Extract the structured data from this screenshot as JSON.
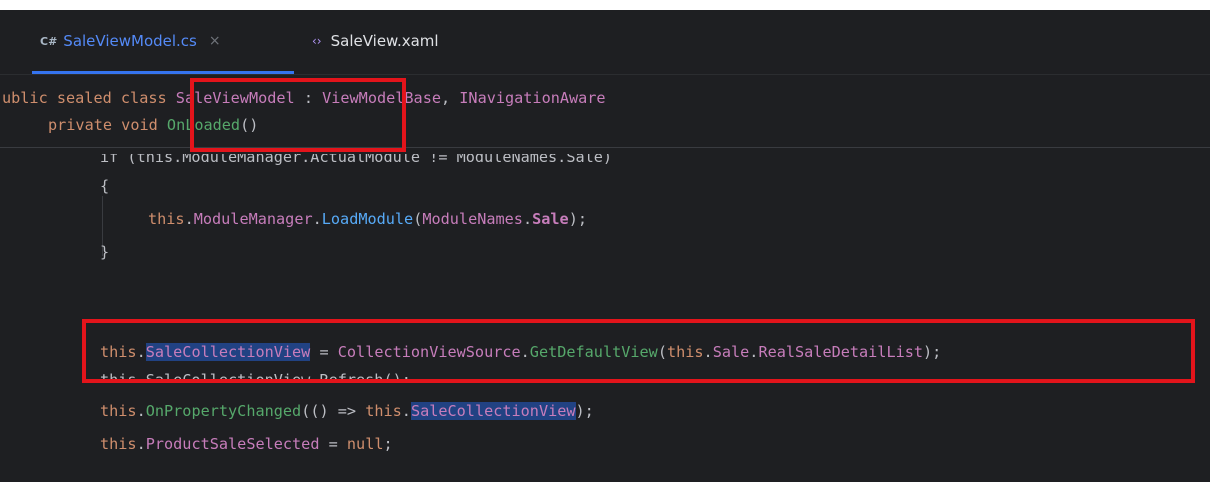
{
  "tabs": [
    {
      "icon": "C#",
      "label": "SaleViewModel.cs",
      "close": "×",
      "active": true
    },
    {
      "icon": "‹›",
      "label": "SaleView.xaml",
      "active": false
    }
  ],
  "sticky": {
    "line1": {
      "kw1": "ublic",
      "kw2": "sealed",
      "kw3": "cl",
      "kw3b": "ass",
      "class_name": "SaleViewModel",
      "sep": " : ",
      "base": "ViewModelBase",
      "comma": ", ",
      "iface": "INavigationAware"
    },
    "line2": {
      "kw1": "private",
      "kw2": "voi",
      "kw2b": "d",
      "method": "OnLoaded",
      "parens": "()"
    }
  },
  "code": {
    "cut_line": "if (this.ModuleManager.ActualModule != ModuleNames.Sale)",
    "open_brace": "{",
    "load_line": {
      "this": "this",
      "dot1": ".",
      "member": "ModuleManager",
      "dot2": ".",
      "method": "LoadModule",
      "open": "(",
      "arg": "ModuleNames",
      "dot3": ".",
      "arg2": "Sale",
      "close": ");"
    },
    "close_brace": "}",
    "line_view": {
      "this": "this",
      "dot1": ".",
      "member": "SaleCollectionView",
      "eq": " = ",
      "cls": "CollectionViewSource",
      "dot2": ".",
      "method": "GetDefaultView",
      "open": "(",
      "this2": "this",
      "dot3": ".",
      "arg": "Sale",
      "dot4": ".",
      "arg2": "RealSaleDetailList",
      "close": ");"
    },
    "refresh_line": "this.SaleCollectionView.Refresh();",
    "prop_line": {
      "this": "this",
      "dot1": ".",
      "method": "OnPropertyChanged",
      "open": "(() => ",
      "this2": "this",
      "dot2": ".",
      "member": "SaleCollectionView",
      "close": ");"
    },
    "null_line": {
      "this": "this",
      "dot1": ".",
      "member": "ProductSaleSelected",
      "eq": " = ",
      "null": "null",
      "semi": ";"
    }
  },
  "colors": {
    "highlight_box": "#e3141b",
    "editor_bg": "#1e1f22"
  }
}
